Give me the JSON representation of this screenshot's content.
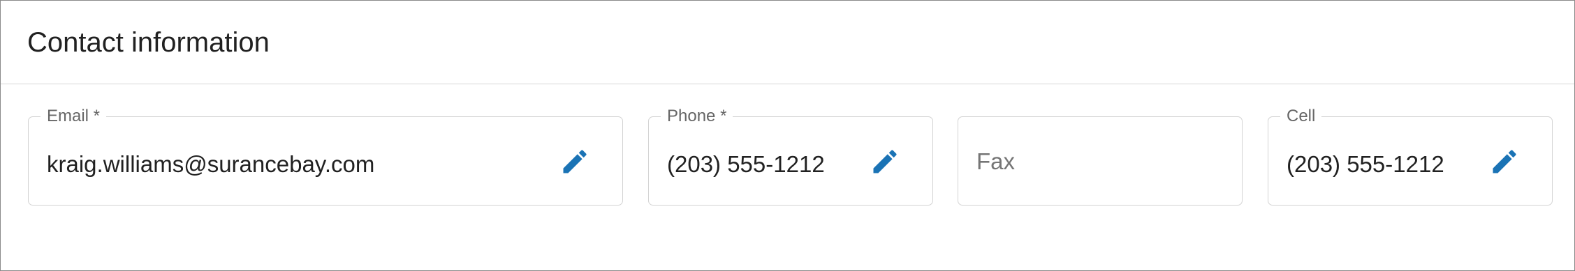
{
  "header": {
    "title": "Contact information"
  },
  "fields": {
    "email": {
      "label": "Email *",
      "value": "kraig.williams@surancebay.com",
      "icon": "pencil-icon"
    },
    "phone": {
      "label": "Phone *",
      "value": "(203) 555-1212",
      "icon": "pencil-icon"
    },
    "fax": {
      "placeholder": "Fax"
    },
    "cell": {
      "label": "Cell",
      "value": "(203) 555-1212",
      "icon": "pencil-icon"
    }
  },
  "colors": {
    "accent": "#1a73b5",
    "border": "#d3d3d3",
    "label": "#666666",
    "text": "#212121"
  }
}
